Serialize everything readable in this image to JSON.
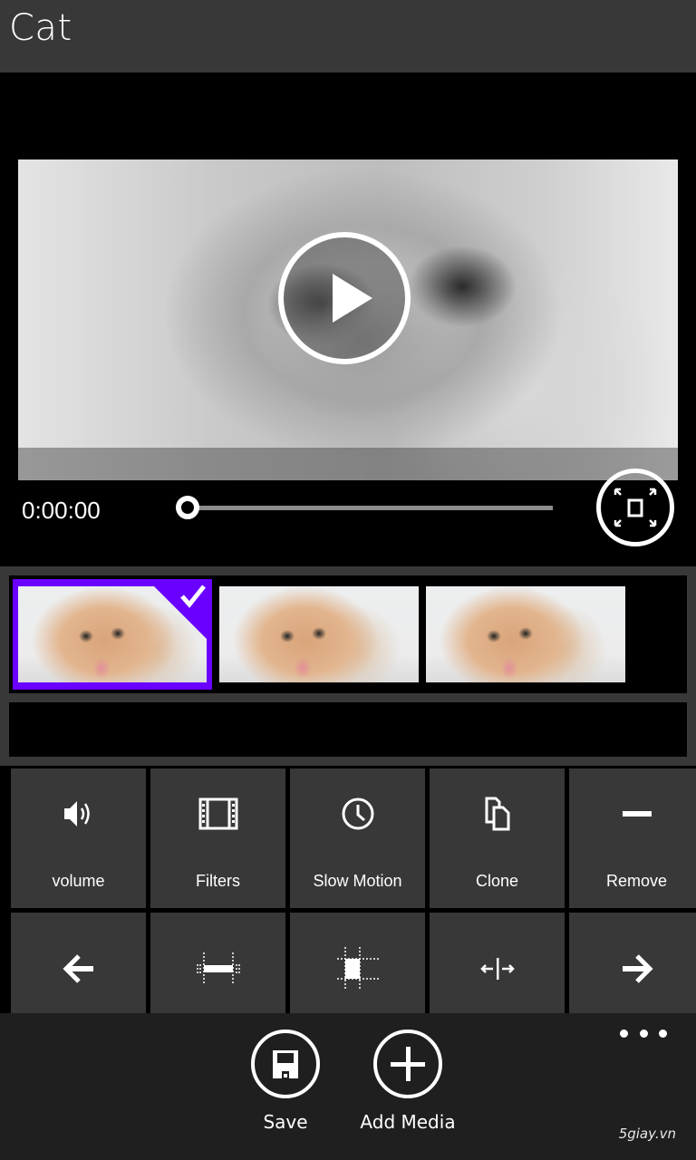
{
  "header": {
    "title": "Cat"
  },
  "player": {
    "time": "0:00:00",
    "progress_fraction": 0.0,
    "play_icon": "play-icon",
    "fullscreen_icon": "fullscreen-expand-icon"
  },
  "timeline": {
    "clips": [
      {
        "name": "cat-clip-1",
        "selected": true
      },
      {
        "name": "cat-clip-2",
        "selected": false
      },
      {
        "name": "cat-clip-3",
        "selected": false
      }
    ],
    "selected_color": "#6a00ff"
  },
  "tools": {
    "row1": [
      {
        "label": "volume",
        "icon": "speaker-icon"
      },
      {
        "label": "Filters",
        "icon": "film-strip-icon"
      },
      {
        "label": "Slow Motion",
        "icon": "clock-icon"
      },
      {
        "label": "Clone",
        "icon": "copy-icon"
      },
      {
        "label": "Remove",
        "icon": "minus-icon"
      }
    ],
    "row2": [
      {
        "icon": "arrow-left-icon"
      },
      {
        "icon": "trim-horizontal-icon"
      },
      {
        "icon": "crop-icon"
      },
      {
        "icon": "split-icon"
      },
      {
        "icon": "arrow-right-icon"
      }
    ]
  },
  "appbar": {
    "save_label": "Save",
    "add_media_label": "Add Media",
    "more_icon": "ellipsis-icon"
  },
  "watermark": "5giay.vn"
}
